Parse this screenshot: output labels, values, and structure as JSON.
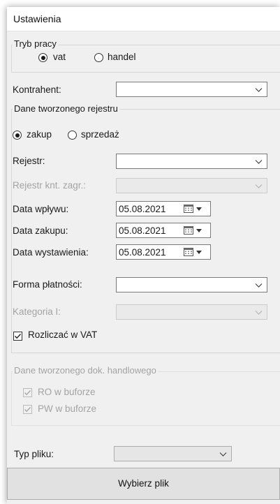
{
  "window": {
    "title": "Ustawienia"
  },
  "tryb_pracy": {
    "legend": "Tryb pracy",
    "options": [
      {
        "label": "vat",
        "selected": true
      },
      {
        "label": "handel",
        "selected": false
      }
    ]
  },
  "kontrahent": {
    "label": "Kontrahent:",
    "value": ""
  },
  "dane_rejestru": {
    "legend": "Dane tworzonego rejestru",
    "type_options": [
      {
        "label": "zakup",
        "selected": true
      },
      {
        "label": "sprzedaż",
        "selected": false
      }
    ],
    "rejestr": {
      "label": "Rejestr:",
      "value": ""
    },
    "rejestr_knt": {
      "label": "Rejestr knt. zagr.:",
      "value": "",
      "enabled": false
    },
    "data_wplywu": {
      "label": "Data wpływu:",
      "value": "05.08.2021"
    },
    "data_zakupu": {
      "label": "Data zakupu:",
      "value": "05.08.2021"
    },
    "data_wystawienia": {
      "label": "Data wystawienia:",
      "value": "05.08.2021"
    },
    "forma_platnosci": {
      "label": "Forma płatności:",
      "value": ""
    },
    "kategoria": {
      "label": "Kategoria I:",
      "value": "",
      "enabled": false
    },
    "rozliczac_vat": {
      "label": "Rozliczać w VAT",
      "checked": true
    }
  },
  "dane_handlowe": {
    "legend": "Dane tworzonego dok. handlowego",
    "enabled": false,
    "ro": {
      "label": "RO w buforze",
      "checked": true
    },
    "pw": {
      "label": "PW w buforze",
      "checked": true
    }
  },
  "typ_pliku": {
    "label": "Typ pliku:",
    "value": ""
  },
  "button": {
    "label": "Wybierz plik"
  }
}
